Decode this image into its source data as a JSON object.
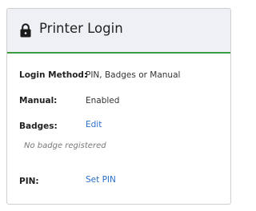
{
  "panel": {
    "title": "Printer Login",
    "icon": "lock-icon"
  },
  "fields": {
    "login_method": {
      "label": "Login Method:",
      "value": "PIN, Badges or Manual"
    },
    "manual": {
      "label": "Manual:",
      "value": "Enabled"
    },
    "badges": {
      "label": "Badges:",
      "action": "Edit",
      "note": "No badge registered"
    },
    "pin": {
      "label": "PIN:",
      "action": "Set PIN"
    }
  },
  "colors": {
    "accent_line": "#3a9d40",
    "link": "#2a70c9",
    "header_bg": "#eef0f5"
  }
}
